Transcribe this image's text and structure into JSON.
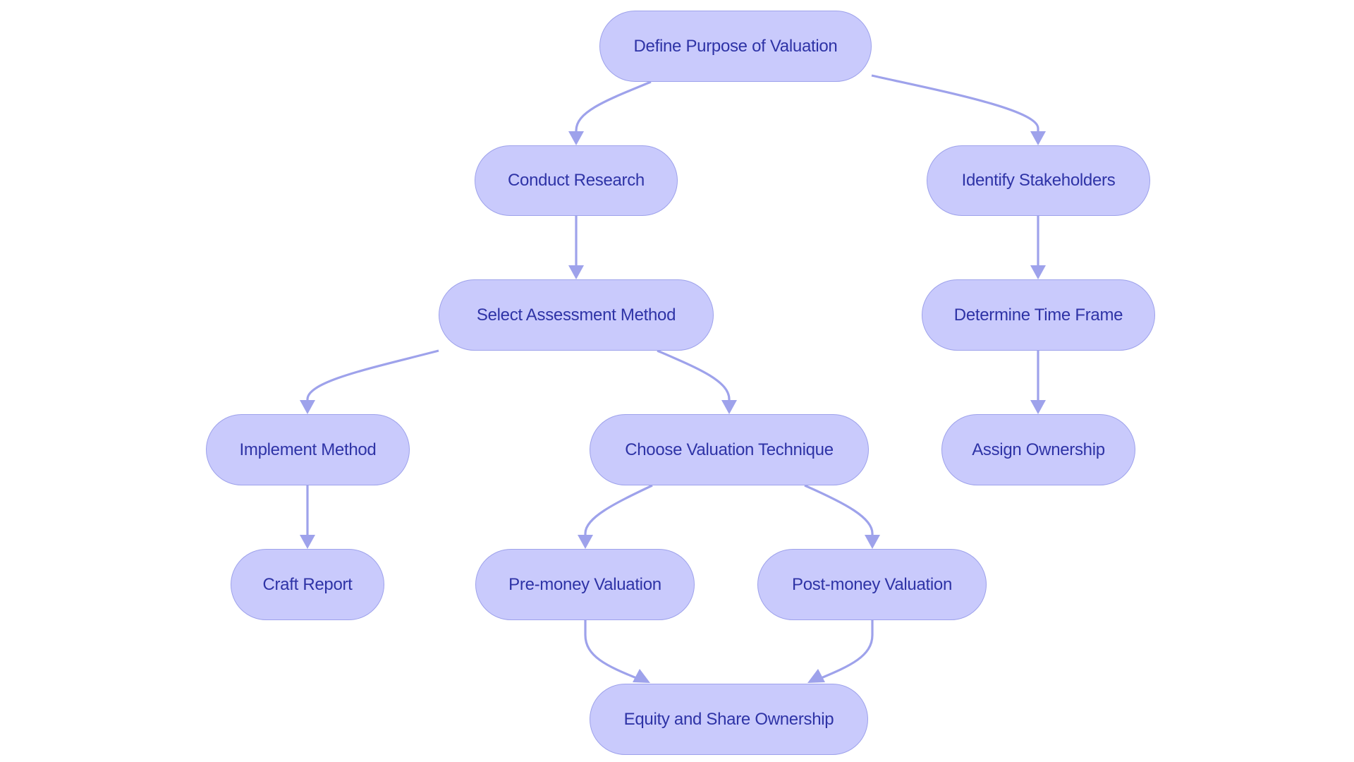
{
  "diagram": {
    "type": "flowchart",
    "colors": {
      "node_fill": "#C9CAFC",
      "node_border": "#9EA2EB",
      "node_text": "#2E33A6",
      "edge": "#9EA2EB",
      "background": "#FFFFFF"
    },
    "nodes": [
      {
        "id": "define_purpose",
        "label": "Define Purpose of Valuation"
      },
      {
        "id": "conduct_research",
        "label": "Conduct Research"
      },
      {
        "id": "identify_stakeholders",
        "label": "Identify Stakeholders"
      },
      {
        "id": "select_method",
        "label": "Select Assessment Method"
      },
      {
        "id": "determine_time_frame",
        "label": "Determine Time Frame"
      },
      {
        "id": "implement_method",
        "label": "Implement Method"
      },
      {
        "id": "choose_technique",
        "label": "Choose Valuation Technique"
      },
      {
        "id": "assign_ownership",
        "label": "Assign Ownership"
      },
      {
        "id": "craft_report",
        "label": "Craft Report"
      },
      {
        "id": "pre_money",
        "label": "Pre-money Valuation"
      },
      {
        "id": "post_money",
        "label": "Post-money Valuation"
      },
      {
        "id": "equity_ownership",
        "label": "Equity and Share Ownership"
      }
    ],
    "edges": [
      {
        "from": "define_purpose",
        "to": "conduct_research"
      },
      {
        "from": "define_purpose",
        "to": "identify_stakeholders"
      },
      {
        "from": "conduct_research",
        "to": "select_method"
      },
      {
        "from": "identify_stakeholders",
        "to": "determine_time_frame"
      },
      {
        "from": "select_method",
        "to": "implement_method"
      },
      {
        "from": "select_method",
        "to": "choose_technique"
      },
      {
        "from": "determine_time_frame",
        "to": "assign_ownership"
      },
      {
        "from": "implement_method",
        "to": "craft_report"
      },
      {
        "from": "choose_technique",
        "to": "pre_money"
      },
      {
        "from": "choose_technique",
        "to": "post_money"
      },
      {
        "from": "pre_money",
        "to": "equity_ownership"
      },
      {
        "from": "post_money",
        "to": "equity_ownership"
      }
    ]
  }
}
